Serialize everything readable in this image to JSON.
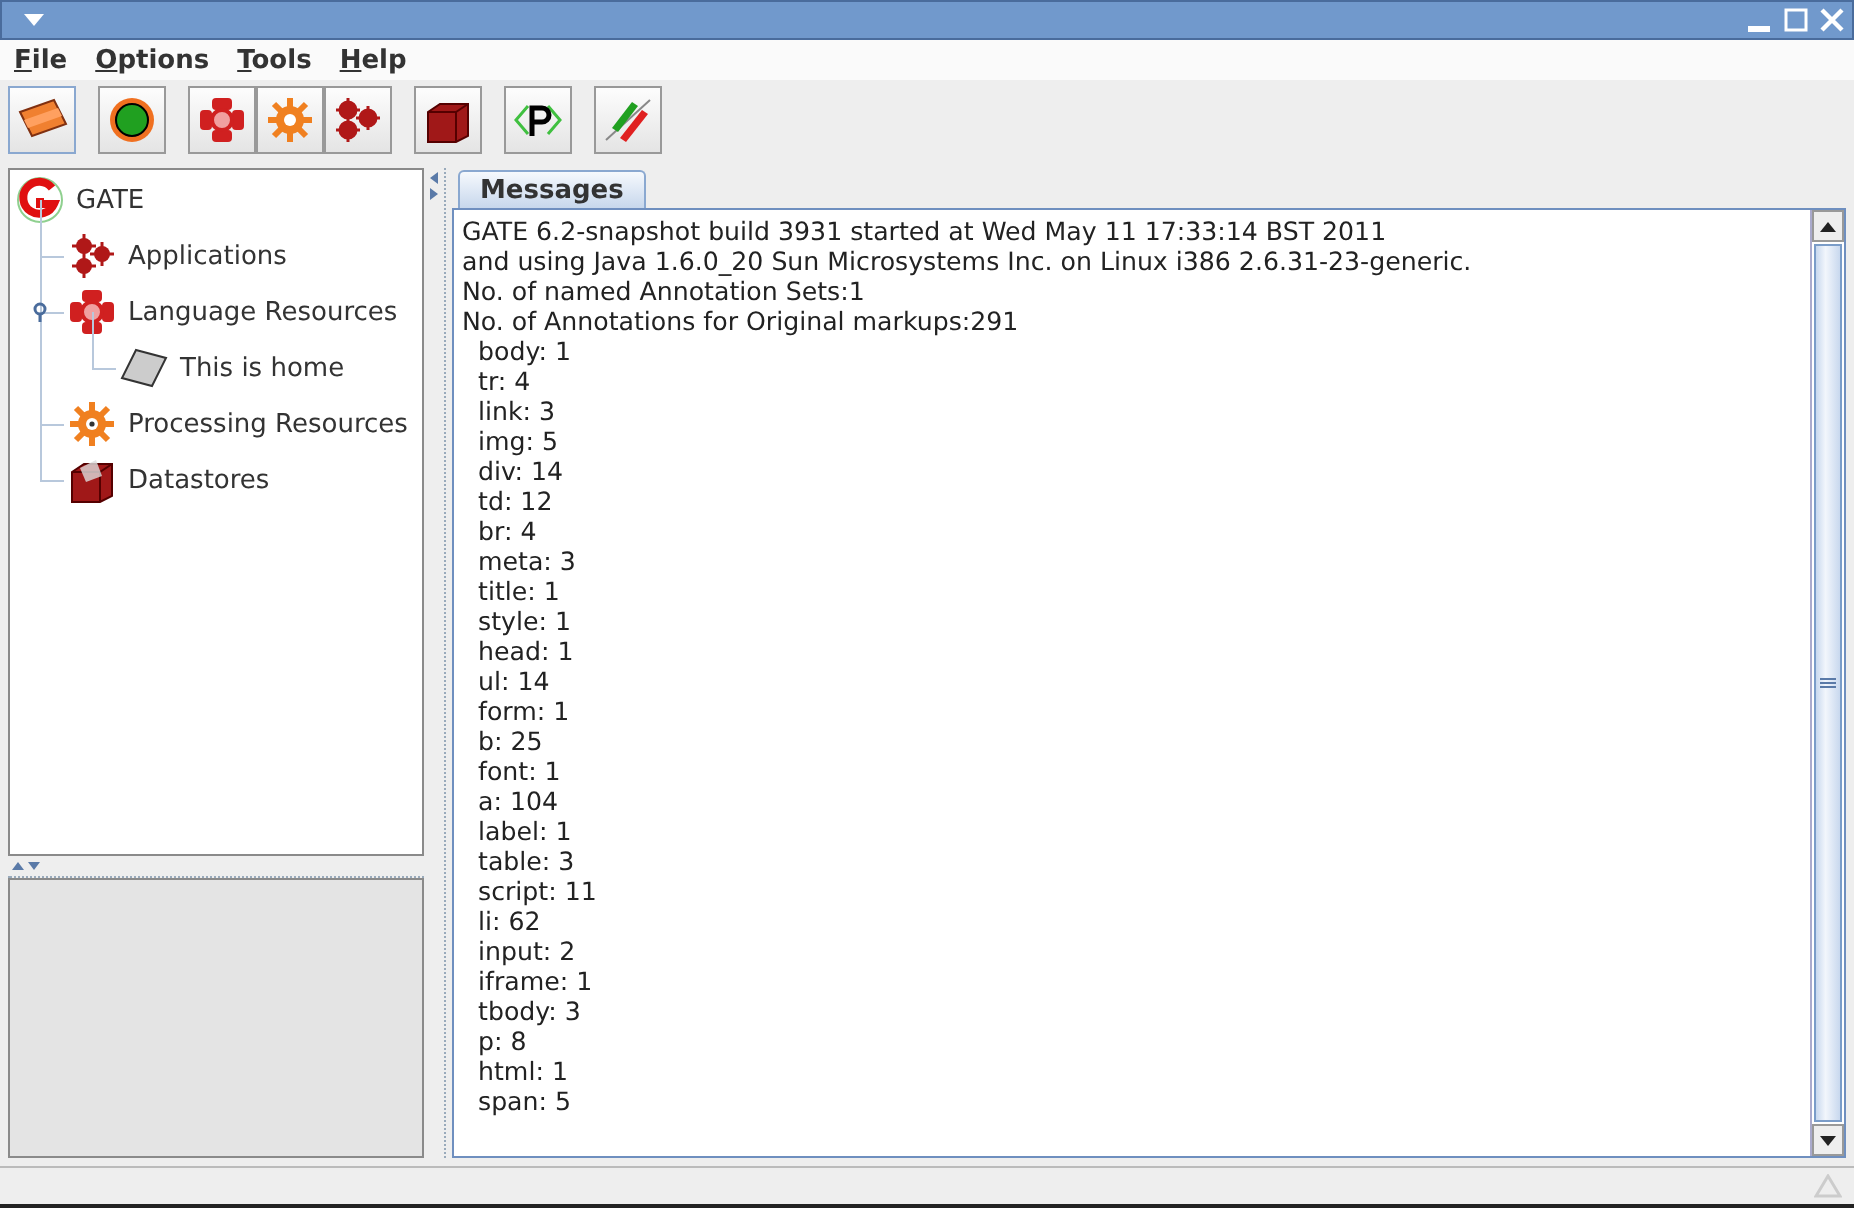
{
  "menu": [
    {
      "label": "File"
    },
    {
      "label": "Options"
    },
    {
      "label": "Tools"
    },
    {
      "label": "Help"
    }
  ],
  "tree": {
    "label": "GATE",
    "kind": "root",
    "children": [
      {
        "label": "Applications",
        "kind": "applications"
      },
      {
        "label": "Language Resources",
        "kind": "language",
        "expanded": true,
        "children": [
          {
            "label": "This is home",
            "kind": "document"
          }
        ]
      },
      {
        "label": "Processing Resources",
        "kind": "processing"
      },
      {
        "label": "Datastores",
        "kind": "datastore"
      }
    ]
  },
  "tabs": [
    {
      "label": "Messages",
      "selected": true
    }
  ],
  "messages": [
    "GATE 6.2-snapshot build 3931 started at Wed May 11 17:33:14 BST 2011",
    "and using Java 1.6.0_20 Sun Microsystems Inc. on Linux i386 2.6.31-23-generic.",
    "No. of named Annotation Sets:1",
    "No. of Annotations for Original markups:291",
    "  body: 1",
    "  tr: 4",
    "  link: 3",
    "  img: 5",
    "  div: 14",
    "  td: 12",
    "  br: 4",
    "  meta: 3",
    "  title: 1",
    "  style: 1",
    "  head: 1",
    "  ul: 14",
    "  form: 1",
    "  b: 25",
    "  font: 1",
    "  a: 104",
    "  label: 1",
    "  table: 3",
    "  script: 11",
    "  li: 62",
    "  input: 2",
    "  iframe: 1",
    "  tbody: 3",
    "  p: 8",
    "  html: 1",
    "  span: 5"
  ]
}
